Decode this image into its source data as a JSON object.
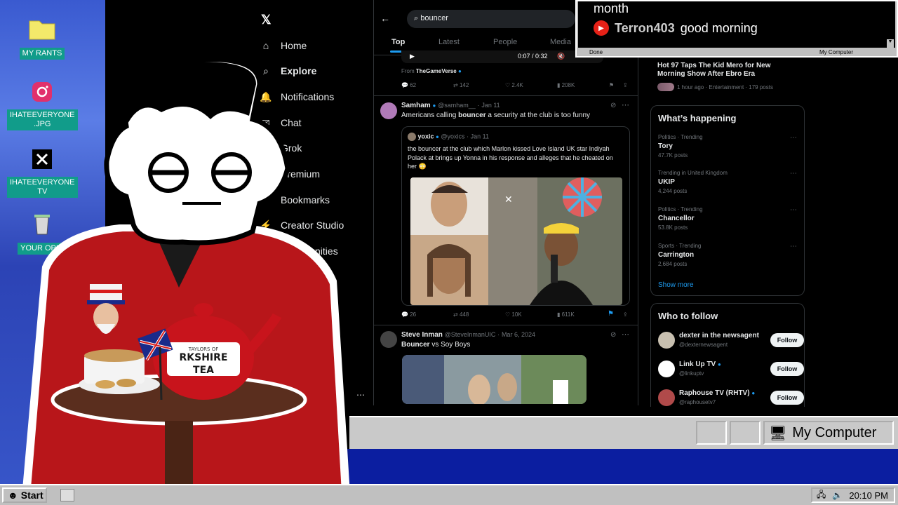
{
  "desktop": {
    "icons": [
      {
        "label": "MY RANTS",
        "icon": "folder-icon"
      },
      {
        "label": "IHATEEVERYONE\n.JPG",
        "icon": "instagram-icon"
      },
      {
        "label": "IHATEEVERYONE\nTV",
        "icon": "x-icon"
      },
      {
        "label": "YOUR OPIN",
        "icon": "recycle-bin-icon"
      }
    ]
  },
  "chat": {
    "line1": "month",
    "user": "Terron403",
    "message": "good morning",
    "status_left": "Done",
    "status_right": "My Computer"
  },
  "x": {
    "nav": [
      {
        "label": "Home",
        "icon": "home-icon"
      },
      {
        "label": "Explore",
        "icon": "search-icon"
      },
      {
        "label": "Notifications",
        "icon": "bell-icon"
      },
      {
        "label": "Chat",
        "icon": "chat-icon"
      },
      {
        "label": "Grok",
        "icon": "grok-icon"
      },
      {
        "label": "Premium",
        "icon": "premium-icon"
      },
      {
        "label": "Bookmarks",
        "icon": "bookmark-icon"
      },
      {
        "label": "Creator Studio",
        "icon": "creator-studio-icon"
      },
      {
        "label": "Communities",
        "icon": "communities-icon"
      }
    ],
    "search": {
      "value": "bouncer"
    },
    "tabs": [
      "Top",
      "Latest",
      "People",
      "Media"
    ],
    "video_time": "0:07 / 0:32",
    "from_label": "From",
    "from_source": "TheGameVerse",
    "post0_actions": {
      "replies": "62",
      "reposts": "142",
      "likes": "2.4K",
      "views": "208K"
    },
    "post1": {
      "name": "Samham",
      "handle": "@samham__",
      "date": "Jan 11",
      "text_pre": "Americans calling ",
      "text_bold": "bouncer",
      "text_post": " a security at the club is too funny",
      "quote": {
        "name": "yoxic",
        "handle": "@yoxics",
        "date": "Jan 11",
        "text": "the bouncer at the club which Marlon kissed Love Island UK star Indiyah Polack at brings up Yonna in his response and alleges that he cheated on her 😳"
      },
      "actions": {
        "replies": "26",
        "reposts": "448",
        "likes": "10K",
        "views": "611K"
      }
    },
    "post2": {
      "name": "Steve Inman",
      "handle": "@SteveInmanUIC",
      "date": "Mar 6, 2024",
      "text_bold": "Bouncer",
      "text_post": " vs Soy Boys"
    },
    "right": {
      "top_trend": {
        "title": "Hot 97 Taps The Kid Mero for New Morning Show After Ebro Era",
        "meta": "1 hour ago · Entertainment · 179 posts"
      },
      "happening_title": "What’s happening",
      "trends": [
        {
          "category": "Politics · Trending",
          "name": "Tory",
          "posts": "47.7K posts"
        },
        {
          "category": "Trending in United Kingdom",
          "name": "UKIP",
          "posts": "4,244 posts"
        },
        {
          "category": "Politics · Trending",
          "name": "Chancellor",
          "posts": "53.8K posts"
        },
        {
          "category": "Sports · Trending",
          "name": "Carrington",
          "posts": "2,684 posts"
        }
      ],
      "show_more": "Show more",
      "who_title": "Who to follow",
      "follow": [
        {
          "name": "dexter in the newsagent",
          "handle": "@dexternewsagent",
          "button": "Follow"
        },
        {
          "name": "Link Up TV",
          "handle": "@linkuptv",
          "button": "Follow"
        },
        {
          "name": "Raphouse TV (RHTV)",
          "handle": "@raphousetv7",
          "button": "Follow"
        }
      ]
    }
  },
  "browser_status": {
    "label": "My Computer"
  },
  "character": {
    "tea_brand_top": "TAYLORS OF",
    "tea_brand": "RKSHIRE",
    "tea_brand2": "TEA"
  },
  "taskbar": {
    "start": "Start",
    "time": "20:10 PM"
  }
}
